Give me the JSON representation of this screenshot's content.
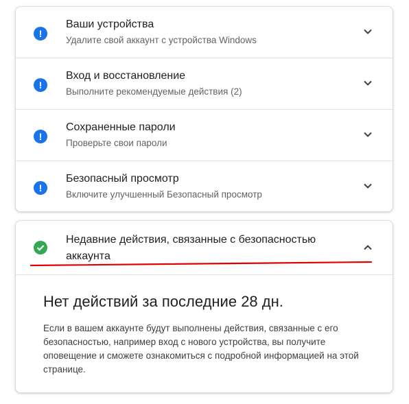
{
  "security_issues": {
    "items": [
      {
        "icon": "alert-icon",
        "title": "Ваши устройства",
        "subtitle": "Удалите свой аккаунт с устройства Windows"
      },
      {
        "icon": "alert-icon",
        "title": "Вход и восстановление",
        "subtitle": "Выполните рекомендуемые действия (2)"
      },
      {
        "icon": "alert-icon",
        "title": "Сохраненные пароли",
        "subtitle": "Проверьте свои пароли"
      },
      {
        "icon": "alert-icon",
        "title": "Безопасный просмотр",
        "subtitle": "Включите улучшенный Безопасный просмотр"
      }
    ],
    "alert_glyph": "!"
  },
  "recent_activity": {
    "icon": "check-circle-icon",
    "title": "Недавние действия, связанные с безопасностью аккаунта",
    "expanded": true,
    "body_title": "Нет действий за последние 28 дн.",
    "body_text": "Если в вашем аккаунте будут выполнены действия, связанные с его безопасностью, например вход с нового устройства, вы получите оповещение и сможете ознакомиться с подробной информацией на этой странице."
  },
  "colors": {
    "alert_blue": "#1a73e8",
    "success_green": "#34a853",
    "annotation_red": "#e00000"
  }
}
